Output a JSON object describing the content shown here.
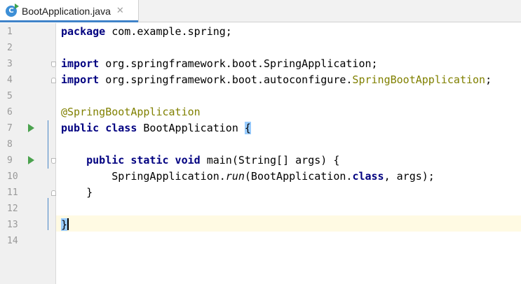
{
  "tab": {
    "icon_letter": "C",
    "file_name": "BootApplication.java",
    "close_glyph": "✕"
  },
  "gutter": {
    "line_numbers": [
      "1",
      "2",
      "3",
      "4",
      "5",
      "6",
      "7",
      "8",
      "9",
      "10",
      "11",
      "12",
      "13",
      "14"
    ]
  },
  "code": {
    "l1_kw": "package",
    "l1_rest": " com.example.spring;",
    "l3_kw": "import",
    "l3_rest": " org.springframework.boot.SpringApplication;",
    "l4_kw": "import",
    "l4_rest": " org.springframework.boot.autoconfigure.",
    "l4_ann": "SpringBootApplication",
    "l4_end": ";",
    "l6_ann": "@SpringBootApplication",
    "l7_kw": "public class",
    "l7_rest": " BootApplication ",
    "l7_brace": "{",
    "l9_indent": "    ",
    "l9_kw": "public static void",
    "l9_rest": " main(String[] args) {",
    "l10_indent": "        SpringApplication.",
    "l10_method": "run",
    "l10_mid": "(BootApplication.",
    "l10_kw": "class",
    "l10_end": ", args);",
    "l11": "    }",
    "l13_brace": "}"
  },
  "colors": {
    "keyword": "#000080",
    "annotation": "#808000",
    "gutter_bg": "#f0f0f0",
    "current_line_bg": "#fffae3",
    "brace_highlight": "#99ccff",
    "run_icon": "#4ba24e",
    "tab_underline": "#4083c9"
  },
  "icons": {
    "file": "java-class-icon",
    "run": "run-play-icon",
    "close": "close-icon"
  }
}
